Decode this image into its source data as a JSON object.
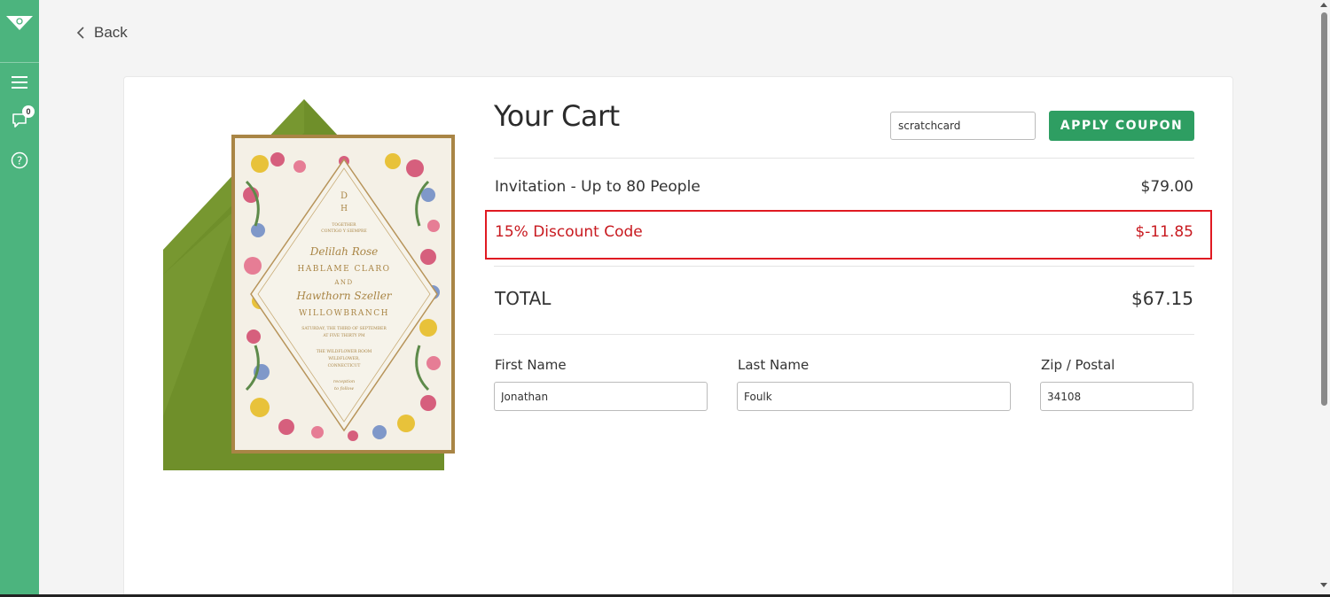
{
  "sidebar": {
    "logo_icon": "evite-logo-icon",
    "items": [
      {
        "icon": "hamburger-menu-icon"
      },
      {
        "icon": "chat-bubble-icon",
        "badge": "0"
      },
      {
        "icon": "help-circle-icon"
      }
    ]
  },
  "nav": {
    "back_label": "Back"
  },
  "cart": {
    "title": "Your Cart",
    "coupon": {
      "value": "scratchcard",
      "button_label": "APPLY COUPON"
    },
    "line_items": [
      {
        "label": "Invitation - Up to 80 People",
        "price": "$79.00"
      }
    ],
    "discount": {
      "label": "15% Discount Code",
      "price": "$-11.85",
      "color": "#c8191f"
    },
    "total": {
      "label": "TOTAL",
      "price": "$67.15"
    }
  },
  "form": {
    "first_name": {
      "label": "First Name",
      "value": "Jonathan"
    },
    "last_name": {
      "label": "Last Name",
      "value": "Foulk"
    },
    "zip": {
      "label": "Zip / Postal",
      "value": "34108"
    }
  },
  "invitation_card": {
    "monogram_top": "D",
    "monogram_bottom": "H",
    "line1": "TOGETHER",
    "line2": "CONTIGO Y SIEMPRE",
    "name1": "Delilah Rose",
    "name1_surname": "HABLAME CLARO",
    "conjunction": "AND",
    "name2": "Hawthorn Szeller",
    "name2_surname": "WILLOWBRANCH",
    "date_line1": "SATURDAY, THE THIRD OF SEPTEMBER",
    "date_line2": "AT FIVE THIRTY PM",
    "venue_line1": "THE WILDFLOWER ROOM",
    "venue_line2": "WILDFLOWER,",
    "venue_line3": "CONNECTICUT",
    "reception_line1": "reception",
    "reception_line2": "to follow"
  },
  "colors": {
    "sidebar": "#4cb47e",
    "primary_button": "#2e9e62",
    "highlight_border": "#e01a22",
    "envelope": "#6f8f2a"
  }
}
